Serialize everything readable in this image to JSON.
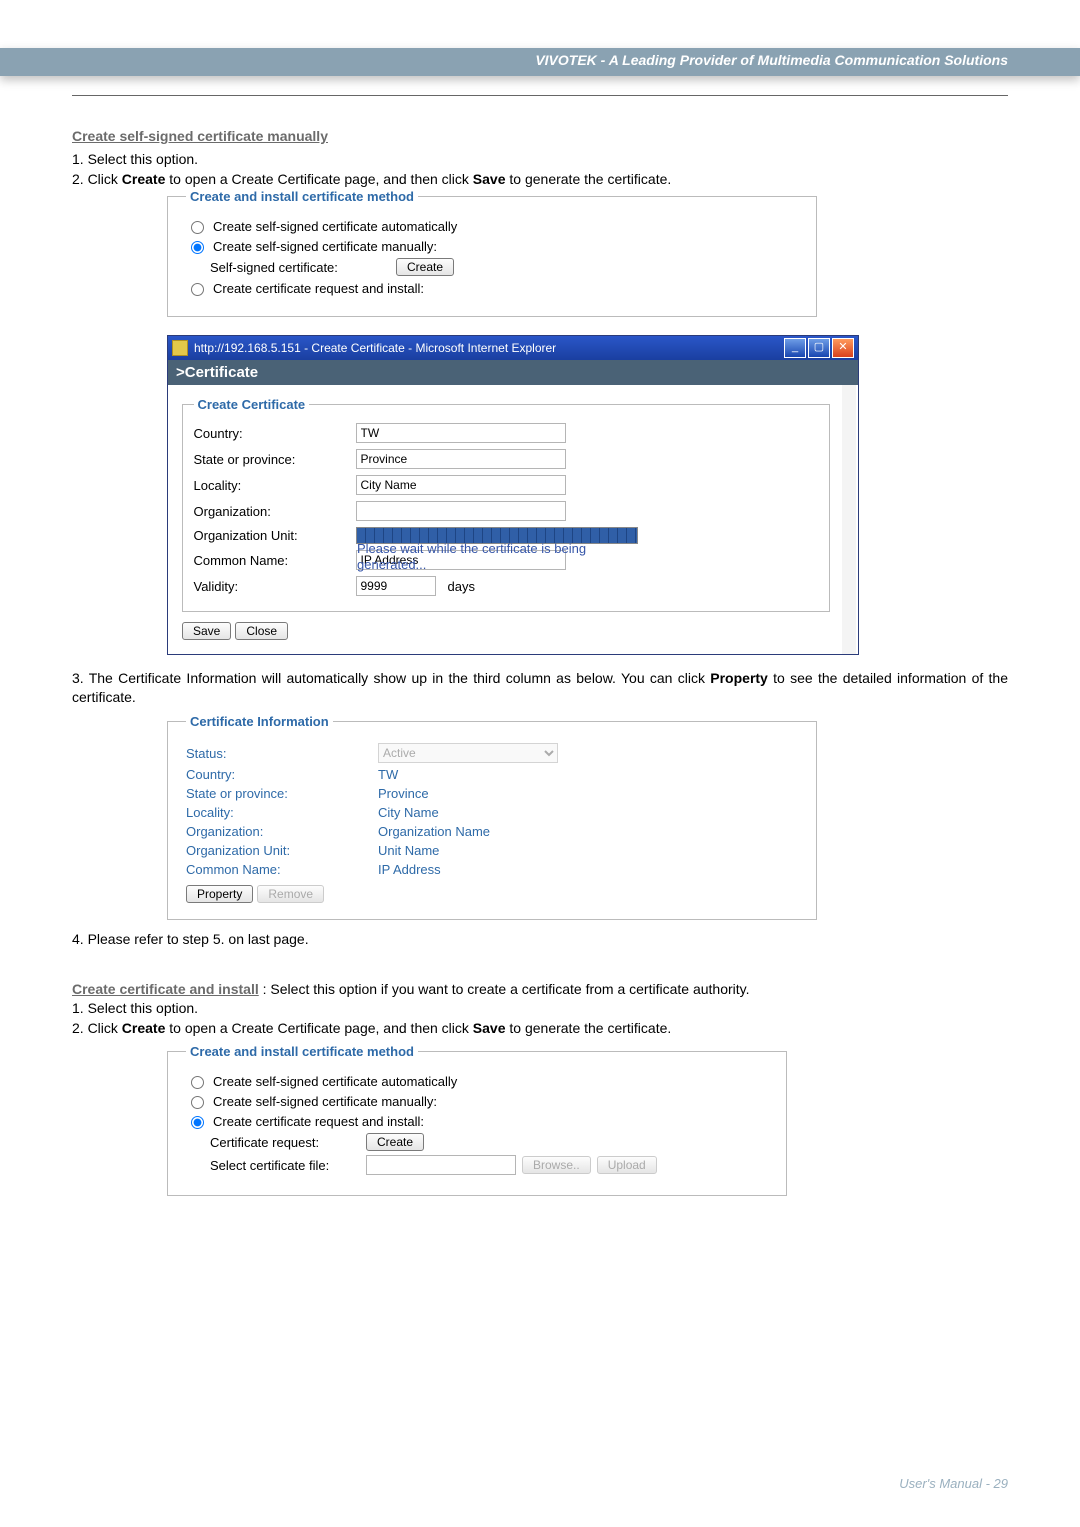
{
  "header_band": "VIVOTEK - A Leading Provider of Multimedia Communication Solutions",
  "section_a": {
    "heading": "Create self-signed certificate manually",
    "step1": "1. Select this option.",
    "step2_pre": "2. Click ",
    "step2_b1": "Create",
    "step2_mid": " to open a Create Certificate page, and then click ",
    "step2_b2": "Save",
    "step2_post": " to generate the certificate."
  },
  "fieldset1": {
    "legend": "Create and install certificate method",
    "opt_auto": "Create self-signed certificate automatically",
    "opt_manual": "Create self-signed certificate manually:",
    "self_signed_label": "Self-signed certificate:",
    "create_btn": "Create",
    "opt_request": "Create certificate request and install:"
  },
  "ie": {
    "title": "http://192.168.5.151 - Create Certificate - Microsoft Internet Explorer",
    "page_head": ">Certificate",
    "legend": "Create Certificate",
    "labels": {
      "country": "Country:",
      "state": "State or province:",
      "locality": "Locality:",
      "organization": "Organization:",
      "orgunit": "Organization Unit:",
      "common": "Common Name:",
      "validity": "Validity:"
    },
    "values": {
      "country": "TW",
      "state": "Province",
      "locality": "City Name",
      "common": "IP Address",
      "validity": "9999",
      "days": "days"
    },
    "overlay_msg": "Please wait while the certificate is being generated...",
    "save_btn": "Save",
    "close_btn": "Close",
    "win_min": "_",
    "win_max": "▢",
    "win_close": "✕"
  },
  "step3": {
    "pre": "3. The Certificate Information will automatically show up in the third column as below. You can click ",
    "b": "Property",
    "post": " to see the detailed information of the certificate."
  },
  "cert_info": {
    "legend": "Certificate Information",
    "labels": {
      "status": "Status:",
      "country": "Country:",
      "state": "State or province:",
      "locality": "Locality:",
      "organization": "Organization:",
      "orgunit": "Organization Unit:",
      "common": "Common Name:"
    },
    "values": {
      "status": "Active",
      "country": "TW",
      "state": "Province",
      "locality": "City Name",
      "organization": "Organization Name",
      "orgunit": "Unit Name",
      "common": "IP Address"
    },
    "property_btn": "Property",
    "remove_btn": "Remove"
  },
  "step4": "4. Please refer to step 5. on last page.",
  "section_b": {
    "heading": "Create certificate and install",
    "body1_pre": " : Select this option if you want to create a certificate from a certificate authority.",
    "step1": "1. Select this option.",
    "step2_pre": "2. Click ",
    "step2_b1": "Create",
    "step2_mid": " to open a Create Certificate page, and then click ",
    "step2_b2": "Save",
    "step2_post": " to generate the certificate."
  },
  "fieldset2": {
    "legend": "Create and install certificate method",
    "opt_auto": "Create self-signed certificate automatically",
    "opt_manual": "Create self-signed certificate manually:",
    "opt_request": "Create certificate request and install:",
    "cert_req_label": "Certificate request:",
    "create_btn": "Create",
    "select_file_label": "Select certificate file:",
    "browse_btn": "Browse..",
    "upload_btn": "Upload"
  },
  "footer": "User's Manual - 29"
}
